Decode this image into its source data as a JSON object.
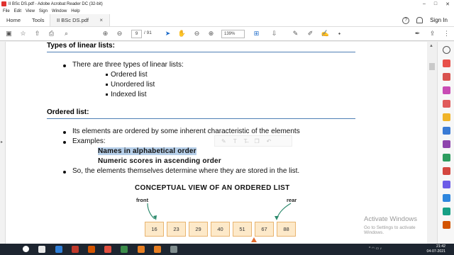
{
  "window": {
    "title": "II BSc DS.pdf - Adobe Acrobat Reader DC (32-bit)"
  },
  "menu": [
    "File",
    "Edit",
    "View",
    "Sign",
    "Window",
    "Help"
  ],
  "tabs": {
    "home": "Home",
    "tools": "Tools",
    "document": "II BSc DS.pdf",
    "close_glyph": "×"
  },
  "header": {
    "sign_in": "Sign In",
    "help_glyph": "?"
  },
  "toolbar": {
    "page_current": "9",
    "page_total": "/ 91",
    "zoom": "139%"
  },
  "document": {
    "heading1": "Types of linear lists:",
    "intro": "There are three types of linear lists:",
    "list_types": [
      "Ordered list",
      "Unordered list",
      "Indexed list"
    ],
    "heading2": "Ordered list:",
    "bullet1": "Its elements are ordered by some inherent characteristic of the elements",
    "bullet2": "Examples:",
    "example1": "Names in alphabetical order",
    "example2": "Numeric scores in ascending order",
    "bullet3": "So, the elements themselves determine where they are stored in the list.",
    "conceptual_title": "CONCEPTUAL VIEW OF AN ORDERED LIST",
    "front_label": "front",
    "rear_label": "rear",
    "list_values": [
      "16",
      "23",
      "29",
      "40",
      "51",
      "67",
      "88"
    ]
  },
  "watermark": {
    "line1": "Activate Windows",
    "line2": "Go to Settings to activate Windows."
  },
  "taskbar": {
    "time": "21:42",
    "date": "04-07-2021"
  },
  "colors": {
    "rule": "#4f7fb5",
    "highlight": "#b6cfe9",
    "box_fill": "#fde9c9",
    "box_border": "#e8b470",
    "arrow": "#2e8b6e"
  }
}
